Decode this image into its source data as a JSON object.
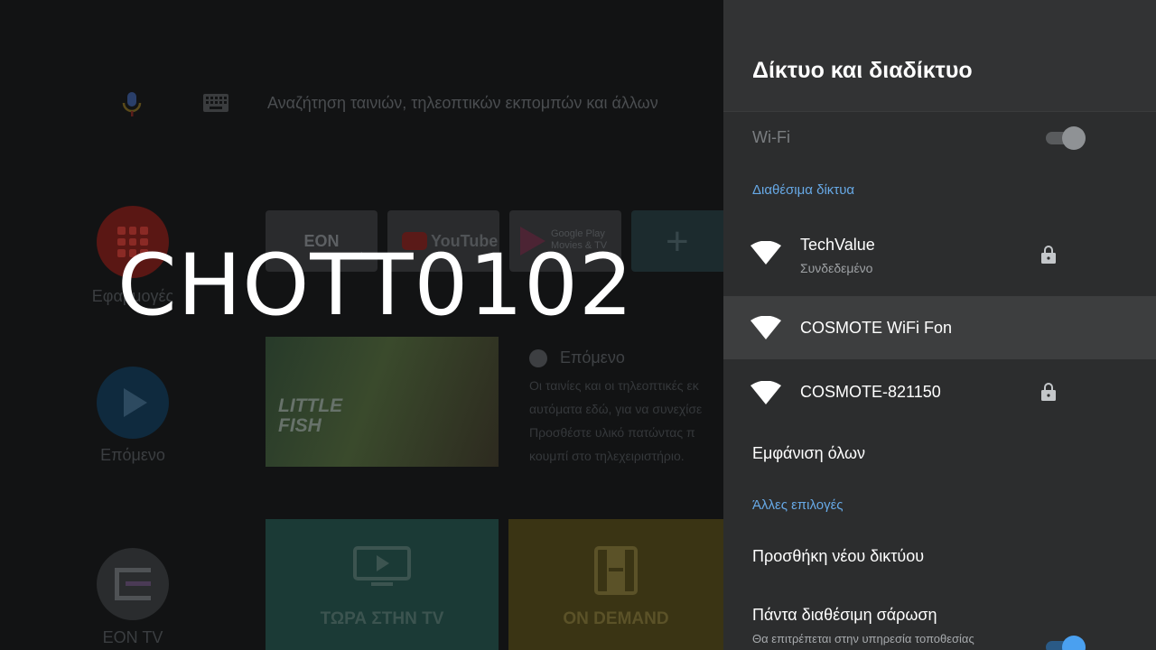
{
  "home": {
    "search_placeholder": "Αναζήτηση ταινιών, τηλεοπτικών εκπομπών και άλλων",
    "rows": {
      "apps_label": "Εφαρμογές",
      "next_label": "Επόμενο",
      "eon_label": "EON TV"
    },
    "apps": {
      "eon": "EON",
      "youtube": "YouTube",
      "play_line1": "Google Play",
      "play_line2": "Movies & TV",
      "add": "+"
    },
    "next": {
      "movie_title_line1": "LITTLE",
      "movie_title_line2": "FISH",
      "heading": "Επόμενο",
      "desc_line1": "Οι ταινίες και οι τηλεοπτικές εκ",
      "desc_line2": "αυτόματα εδώ, για να συνεχίσε",
      "desc_line3": "Προσθέστε υλικό πατώντας π",
      "desc_line4": "κουμπί στο τηλεχειριστήριο."
    },
    "channels": {
      "tv_label": "ΤΩΡΑ ΣΤΗΝ TV",
      "ondemand_label": "ON DEMAND"
    }
  },
  "watermark": "CHOTT0102",
  "panel": {
    "title": "Δίκτυο και διαδίκτυο",
    "wifi_label": "Wi-Fi",
    "wifi_enabled": true,
    "available_header": "Διαθέσιμα δίκτυα",
    "networks": [
      {
        "name": "TechValue",
        "status": "Συνδεδεμένο",
        "locked": true,
        "icon": "wifi-icon"
      },
      {
        "name": "COSMOTE WiFi Fon",
        "status": "",
        "locked": false,
        "icon": "wifi-icon"
      },
      {
        "name": "COSMOTE-821150",
        "status": "",
        "locked": true,
        "icon": "wifi-icon"
      }
    ],
    "show_all": "Εμφάνιση όλων",
    "other_header": "Άλλες επιλογές",
    "add_network": "Προσθήκη νέου δικτύου",
    "always_scan": "Πάντα διαθέσιμη σάρωση",
    "always_scan_desc": "Θα επιτρέπεται στην υπηρεσία τοποθεσίας",
    "always_scan_enabled": true
  },
  "colors": {
    "accent": "#67a9e6",
    "panel_bg": "#2c2d2e",
    "selected_row": "#3d3e3f"
  }
}
